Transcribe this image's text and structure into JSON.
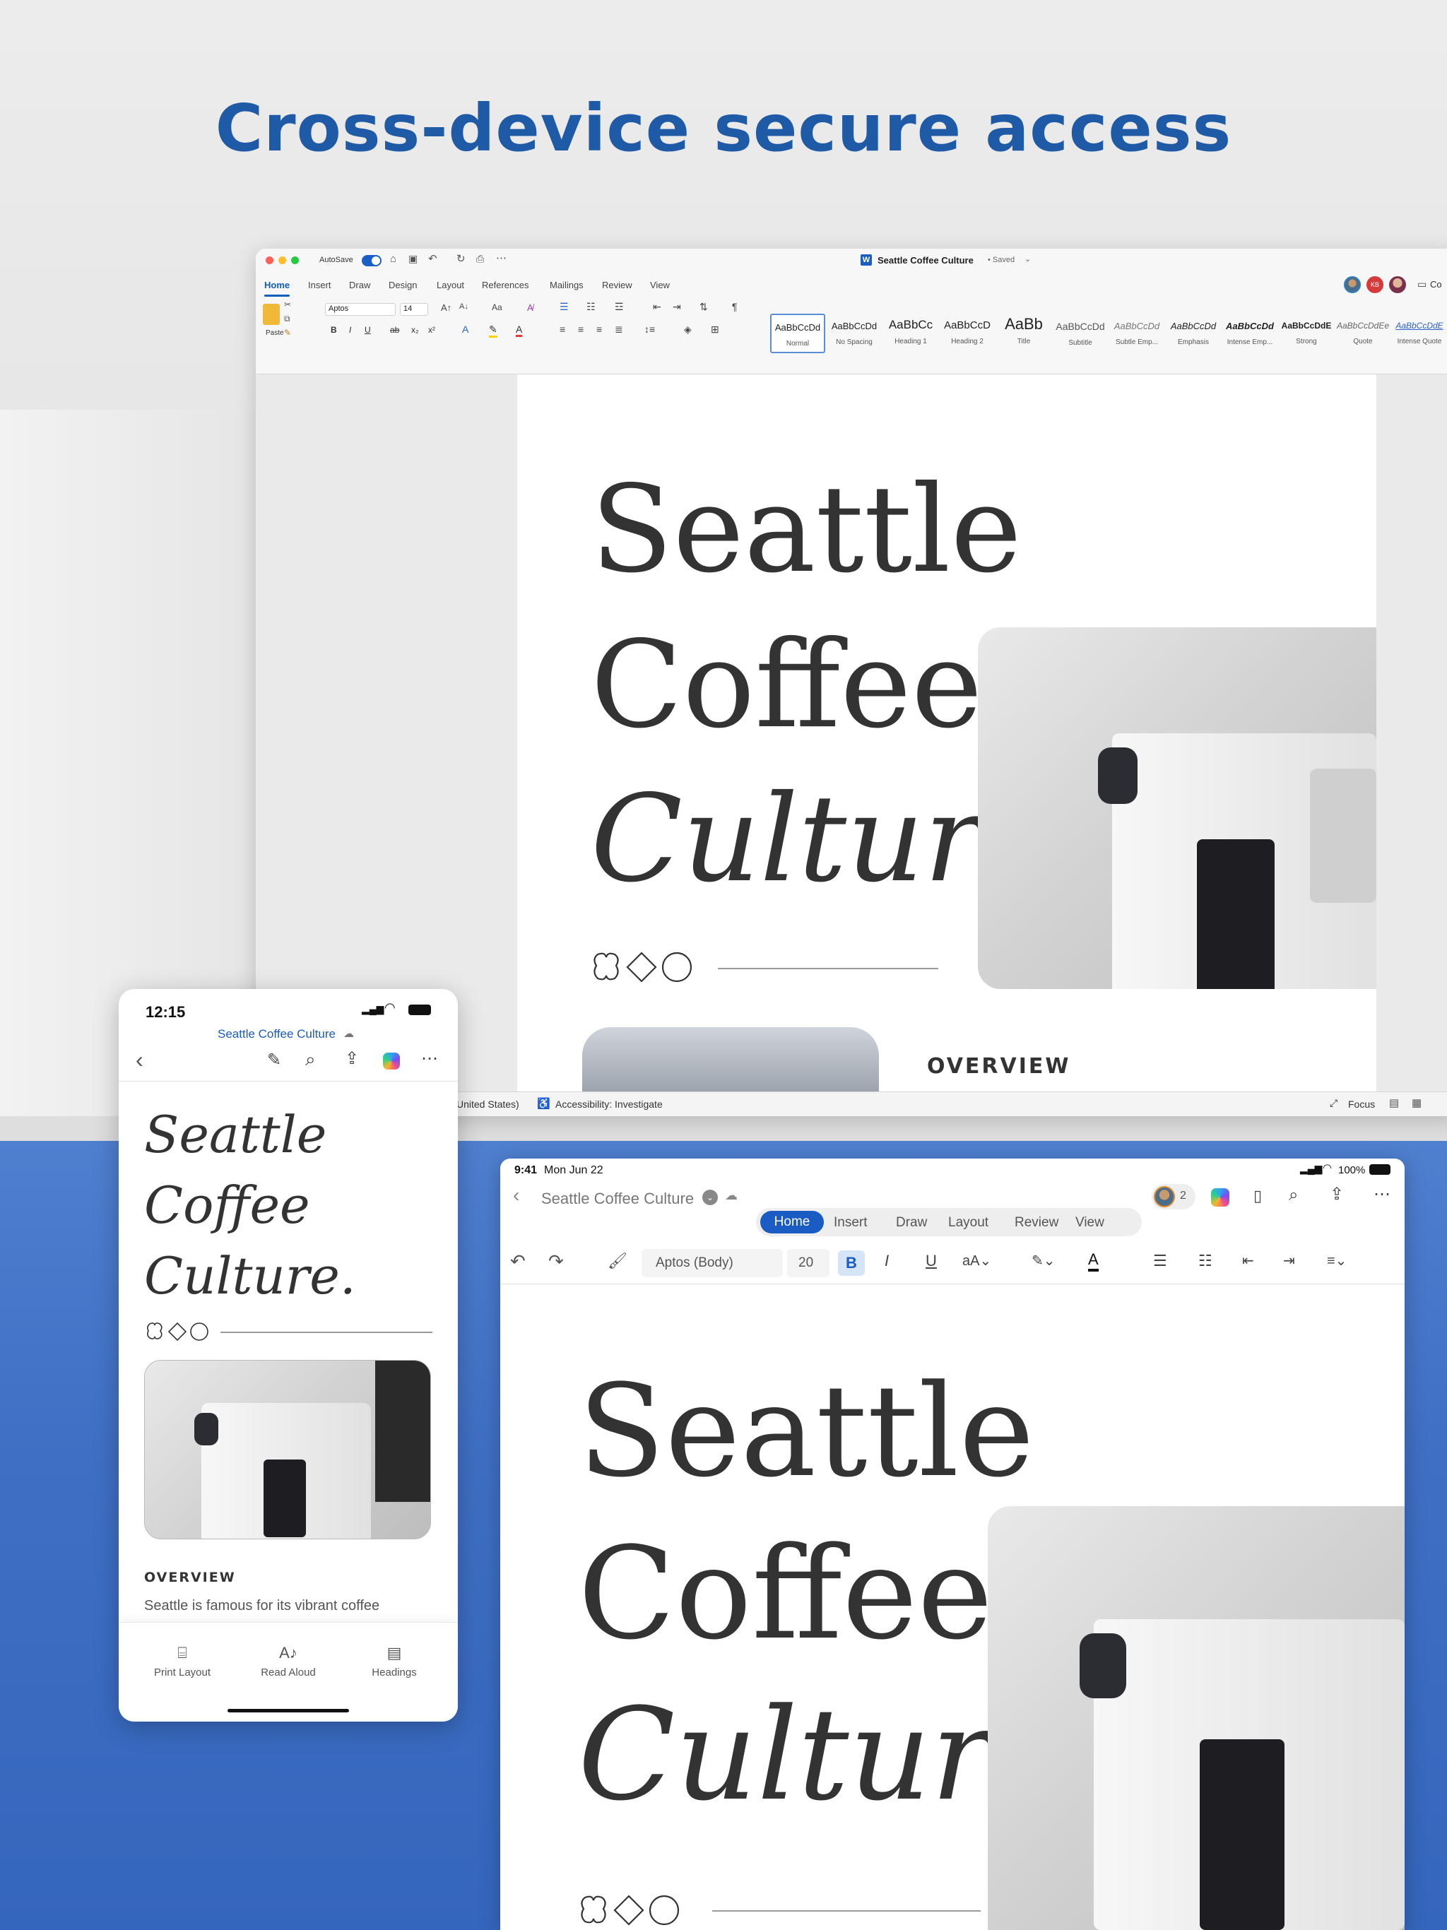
{
  "headline": "Cross-device secure access",
  "colors": {
    "accent": "#1f5aa6",
    "word_blue": "#0f5dbd",
    "ipad_home": "#1a5bc4"
  },
  "mac": {
    "autosave_label": "AutoSave",
    "doc_title": "Seattle Coffee Culture",
    "saved_status": "• Saved",
    "avatar_initials": "KB",
    "comments_label": "Co",
    "tabs": [
      "Home",
      "Insert",
      "Draw",
      "Design",
      "Layout",
      "References",
      "Mailings",
      "Review",
      "View"
    ],
    "paste_label": "Paste",
    "font_name": "Aptos",
    "font_size": "14",
    "styles": [
      {
        "sample": "AaBbCcDd",
        "name": "Normal"
      },
      {
        "sample": "AaBbCcDd",
        "name": "No Spacing"
      },
      {
        "sample": "AaBbCc",
        "name": "Heading 1"
      },
      {
        "sample": "AaBbCcD",
        "name": "Heading 2"
      },
      {
        "sample": "AaBb",
        "name": "Title"
      },
      {
        "sample": "AaBbCcDd",
        "name": "Subtitle"
      },
      {
        "sample": "AaBbCcDd",
        "name": "Subtle Emp..."
      },
      {
        "sample": "AaBbCcDd",
        "name": "Emphasis"
      },
      {
        "sample": "AaBbCcDd",
        "name": "Intense Emp..."
      },
      {
        "sample": "AaBbCcDdE",
        "name": "Strong"
      },
      {
        "sample": "AaBbCcDdEe",
        "name": "Quote"
      },
      {
        "sample": "AaBbCcDdE",
        "name": "Intense Quote"
      }
    ],
    "doc": {
      "line1": "Seattle",
      "line2": "Coffee",
      "line3": "Culture.",
      "overview": "OVERVIEW"
    },
    "status_lang": "United States)",
    "status_accessibility": "Accessibility: Investigate",
    "status_focus": "Focus"
  },
  "phone": {
    "time": "12:15",
    "doc_title": "Seattle Coffee Culture",
    "doc": {
      "line1": "Seattle",
      "line2": "Coffee",
      "line3": "Culture.",
      "overview": "OVERVIEW",
      "body": "Seattle is famous for its vibrant coffee"
    },
    "bottom_bar": [
      {
        "icon": "print-layout-icon",
        "label": "Print Layout"
      },
      {
        "icon": "read-aloud-icon",
        "label": "Read Aloud"
      },
      {
        "icon": "headings-icon",
        "label": "Headings"
      }
    ]
  },
  "ipad": {
    "time": "9:41",
    "date": "Mon Jun 22",
    "battery": "100%",
    "doc_title": "Seattle Coffee Culture",
    "collab_count": "2",
    "tabs": [
      "Home",
      "Insert",
      "Draw",
      "Layout",
      "Review",
      "View"
    ],
    "font_name": "Aptos (Body)",
    "font_size": "20",
    "doc": {
      "line1": "Seattle",
      "line2": "Coffee",
      "line3": "Culture."
    }
  }
}
